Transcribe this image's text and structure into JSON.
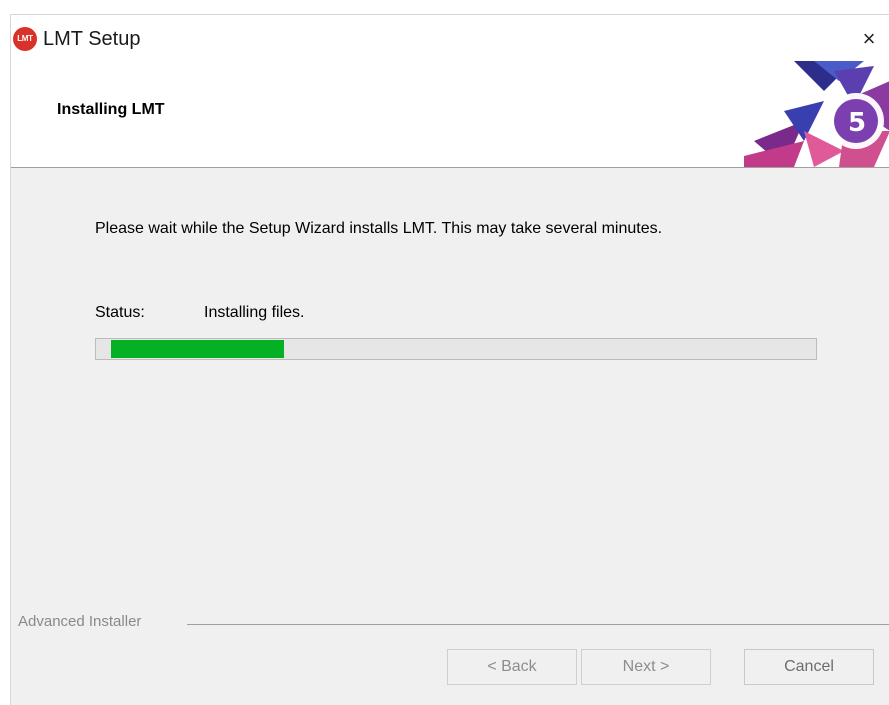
{
  "window": {
    "title": "LMT Setup",
    "icon_text": "LMT",
    "close_icon": "×"
  },
  "header": {
    "title": "Installing LMT"
  },
  "main": {
    "description": "Please wait while the Setup Wizard installs LMT.  This may take several minutes.",
    "status_label": "Status:",
    "status_text": "Installing files.",
    "progress_fraction": 0.25,
    "progress_color": "#06b025"
  },
  "footer": {
    "brand": "Advanced Installer",
    "back_label": "< Back",
    "next_label": "Next >",
    "cancel_label": "Cancel"
  }
}
